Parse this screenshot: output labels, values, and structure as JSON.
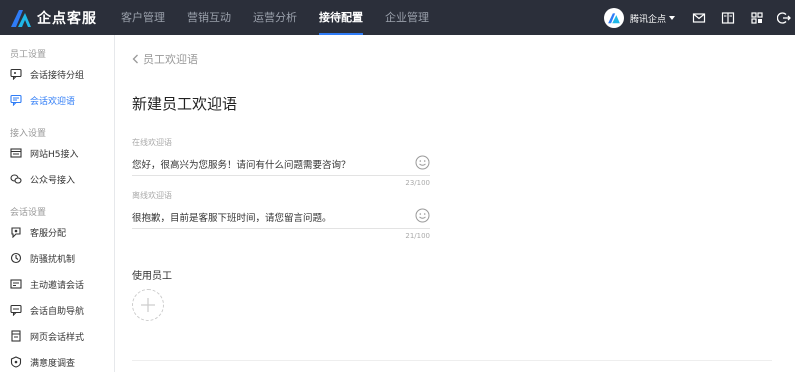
{
  "app": {
    "name": "企点客服",
    "brand_color": "#2f7cf6",
    "topbar_color": "#2b2f3a"
  },
  "nav": {
    "items": [
      {
        "label": "客户管理",
        "active": false
      },
      {
        "label": "营销互动",
        "active": false
      },
      {
        "label": "运营分析",
        "active": false
      },
      {
        "label": "接待配置",
        "active": true
      },
      {
        "label": "企业管理",
        "active": false
      }
    ]
  },
  "account": {
    "name": "腾讯企点"
  },
  "topbar_icons": [
    "mail-icon",
    "book-icon",
    "apps-grid-icon",
    "logout-icon"
  ],
  "sidebar": {
    "sections": [
      {
        "title": "员工设置",
        "items": [
          {
            "label": "会话接待分组",
            "icon": "group-chat-icon",
            "active": false
          },
          {
            "label": "会话欢迎语",
            "icon": "welcome-message-icon",
            "active": true
          }
        ]
      },
      {
        "title": "接入设置",
        "items": [
          {
            "label": "网站H5接入",
            "icon": "web-window-icon",
            "active": false
          },
          {
            "label": "公众号接入",
            "icon": "wechat-icon",
            "active": false
          }
        ]
      },
      {
        "title": "会话设置",
        "items": [
          {
            "label": "客服分配",
            "icon": "assign-icon",
            "active": false
          },
          {
            "label": "防骚扰机制",
            "icon": "shield-icon",
            "active": false
          },
          {
            "label": "主动邀请会话",
            "icon": "invite-icon",
            "active": false
          },
          {
            "label": "会话自助导航",
            "icon": "navigation-icon",
            "active": false
          },
          {
            "label": "网页会话样式",
            "icon": "page-style-icon",
            "active": false
          },
          {
            "label": "满意度调查",
            "icon": "survey-icon",
            "active": false
          }
        ]
      }
    ]
  },
  "main": {
    "back_label": "员工欢迎语",
    "title": "新建员工欢迎语",
    "online": {
      "label": "在线欢迎语",
      "value": "您好，很高兴为您服务！请问有什么问题需要咨询？",
      "counter": "23/100"
    },
    "offline": {
      "label": "离线欢迎语",
      "value": "很抱歉，目前是客服下班时间，请您留言问题。",
      "counter": "21/100"
    },
    "staff_label": "使用员工"
  }
}
